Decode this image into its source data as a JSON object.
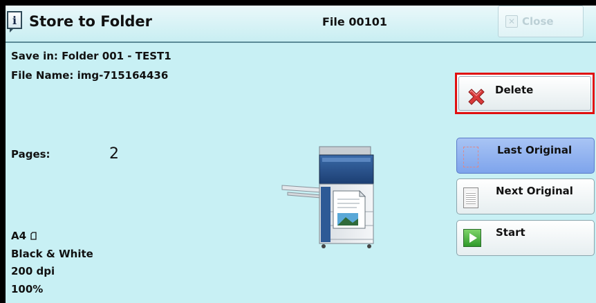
{
  "window": {
    "title": "Store to Folder",
    "file_label": "File 00101",
    "close_label": "Close"
  },
  "info": {
    "save_in": "Save in: Folder 001 - TEST1",
    "file_name": "File Name: img-715164436",
    "pages_label": "Pages:",
    "pages_value": "2",
    "paper_size": "A4",
    "color_mode": "Black & White",
    "resolution": "200 dpi",
    "scale": "100%"
  },
  "actions": {
    "delete_label": "Delete",
    "last_original_label": "Last Original",
    "next_original_label": "Next Original",
    "start_label": "Start"
  },
  "icons": {
    "info": "info-icon",
    "close": "close-icon",
    "delete": "red-x-icon",
    "last_original": "dashed-page-icon",
    "next_original": "page-icon",
    "start": "green-play-icon",
    "device": "multifunction-printer-icon",
    "orientation": "portrait-page-icon"
  },
  "colors": {
    "background": "#c8f0f4",
    "highlight": "#e01010",
    "selected_button": "#8fb0f0"
  }
}
